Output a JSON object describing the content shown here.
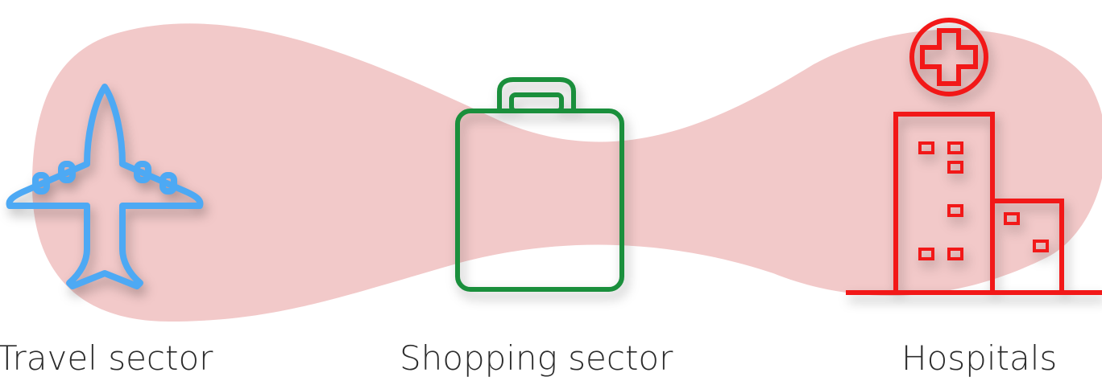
{
  "sectors": [
    {
      "label": "Travel sector",
      "icon": "airplane-icon",
      "color": "#4da9f4"
    },
    {
      "label": "Shopping sector",
      "icon": "briefcase-icon",
      "color": "#1a8f3c"
    },
    {
      "label": "Hospitals",
      "icon": "hospital-icon",
      "color": "#f21818"
    }
  ],
  "background_color": "#f2c9c9"
}
